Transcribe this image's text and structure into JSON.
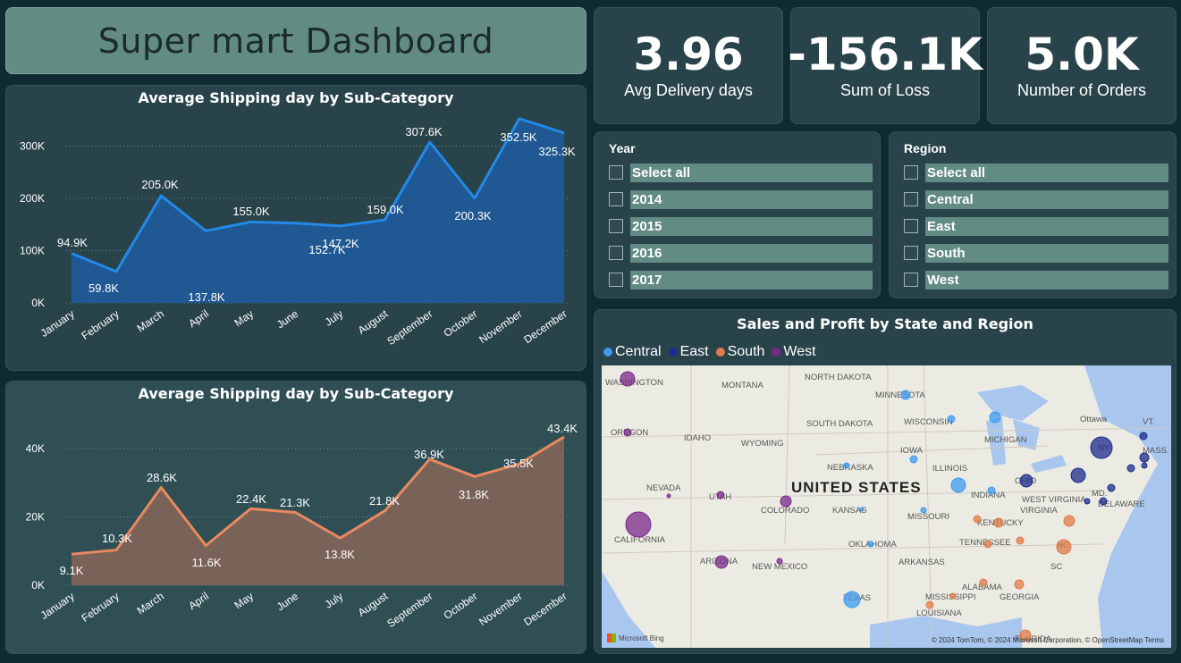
{
  "dashboard": {
    "title": "Super mart Dashboard"
  },
  "kpis": [
    {
      "value": "3.96",
      "label": "Avg Delivery days"
    },
    {
      "value": "-156.1K",
      "label": "Sum of Loss"
    },
    {
      "value": "5.0K",
      "label": "Number of Orders"
    }
  ],
  "slicers": {
    "year": {
      "title": "Year",
      "items": [
        "Select all",
        "2014",
        "2015",
        "2016",
        "2017"
      ]
    },
    "region": {
      "title": "Region",
      "items": [
        "Select all",
        "Central",
        "East",
        "South",
        "West"
      ]
    }
  },
  "map": {
    "title": "Sales and Profit by State and Region",
    "legend": [
      {
        "label": "Central",
        "color": "#3d9bf0"
      },
      {
        "label": "East",
        "color": "#1c2b8c"
      },
      {
        "label": "South",
        "color": "#e07b4a"
      },
      {
        "label": "West",
        "color": "#7b2a8a"
      }
    ],
    "country_label": "UNITED STATES",
    "state_labels": [
      "WASHINGTON",
      "MONTANA",
      "NORTH DAKOTA",
      "MINNESOTA",
      "OREGON",
      "IDAHO",
      "SOUTH DAKOTA",
      "WISCONSIN",
      "MICHIGAN",
      "WYOMING",
      "IOWA",
      "NEBRASKA",
      "ILLINOIS",
      "INDIANA",
      "OHIO",
      "NEVADA",
      "UTAH",
      "COLORADO",
      "KANSAS",
      "MISSOURI",
      "KENTUCKY",
      "WEST VIRGINIA",
      "VIRGINIA",
      "CALIFORNIA",
      "ARIZONA",
      "NEW MEXICO",
      "OKLAHOMA",
      "ARKANSAS",
      "TENNESSEE",
      "NC",
      "SC",
      "TEXAS",
      "MISSISSIPPI",
      "ALABAMA",
      "GEORGIA",
      "LOUISIANA",
      "FLORIDA",
      "Ottawa",
      "VT.",
      "NY",
      "MASS.",
      "MD.",
      "DELAWARE"
    ],
    "attribution": "© 2024 TomTom, © 2024 Microsoft Corporation, © OpenStreetMap  Terms",
    "brand": "Microsoft Bing"
  },
  "chart_data": [
    {
      "type": "area",
      "title": "Average Shipping day by Sub-Category",
      "categories": [
        "January",
        "February",
        "March",
        "April",
        "May",
        "June",
        "July",
        "August",
        "September",
        "October",
        "November",
        "December"
      ],
      "values": [
        94.9,
        59.8,
        205.0,
        137.8,
        155.0,
        152.7,
        147.2,
        159.0,
        307.6,
        200.3,
        352.5,
        325.3
      ],
      "data_labels": [
        "94.9K",
        "59.8K",
        "205.0K",
        "137.8K",
        "155.0K",
        "",
        "152.7K",
        "147.2K",
        "159.0K",
        "307.6K",
        "200.3K",
        "352.5K",
        "325.3K"
      ],
      "yticks": [
        "0K",
        "100K",
        "200K",
        "300K"
      ],
      "ylim": [
        0,
        330
      ],
      "color": "#2389e8",
      "fill": "#1f5a96"
    },
    {
      "type": "area",
      "title": "Average Shipping day by Sub-Category",
      "categories": [
        "January",
        "February",
        "March",
        "April",
        "May",
        "June",
        "July",
        "August",
        "September",
        "October",
        "November",
        "December"
      ],
      "values": [
        9.1,
        10.3,
        28.6,
        11.6,
        22.4,
        21.3,
        13.8,
        21.8,
        36.9,
        31.8,
        35.5,
        43.4
      ],
      "data_labels": [
        "9.1K",
        "10.3K",
        "28.6K",
        "11.6K",
        "22.4K",
        "21.3K",
        "13.8K",
        "21.8K",
        "36.9K",
        "31.8K",
        "35.5K",
        "43.4K"
      ],
      "yticks": [
        "0K",
        "20K",
        "40K"
      ],
      "ylim": [
        0,
        46
      ],
      "color": "#e8895e",
      "fill": "#7d6357"
    }
  ]
}
